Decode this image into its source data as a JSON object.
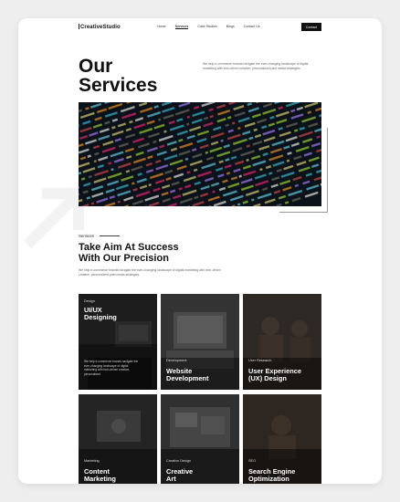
{
  "header": {
    "logo": "CreativeStudio",
    "nav": [
      "Home",
      "Services",
      "Case Studies",
      "Blogs",
      "Contact Us"
    ],
    "active_nav": "Services",
    "cta": "Contact"
  },
  "hero": {
    "title_line1": "Our",
    "title_line2": "Services",
    "description": "We help e-commerce brands navigate the ever-changing landscape of digital marketing with tech-driven creative, personalized paid media strategies."
  },
  "services": {
    "label": "Services",
    "title_line1": "Take Aim At Success",
    "title_line2": "With Our Precision",
    "description": "We help e-commerce brands navigate the ever-changing landscape of digital marketing with tech-driven creative, personalized paid media strategies."
  },
  "cards": [
    {
      "category": "Design",
      "title": "UI/UX\nDesigning",
      "description": "We help e-commerce brands navigate the ever-changing landscape of digital marketing with tech-driven creative, personalized"
    },
    {
      "category": "Development",
      "title": "Website\nDevelopment",
      "description": ""
    },
    {
      "category": "User Research",
      "title": "User Experience\n(UX) Design",
      "description": ""
    },
    {
      "category": "Marketing",
      "title": "Content\nMarketing",
      "description": ""
    },
    {
      "category": "Creative Design",
      "title": "Creative\nArt",
      "description": ""
    },
    {
      "category": "SEO",
      "title": "Search Engine\nOptimization",
      "description": ""
    }
  ],
  "colors": {
    "accent": "#111111",
    "card_bg": "#1c1c1c",
    "code_bg": "#0b1219"
  }
}
